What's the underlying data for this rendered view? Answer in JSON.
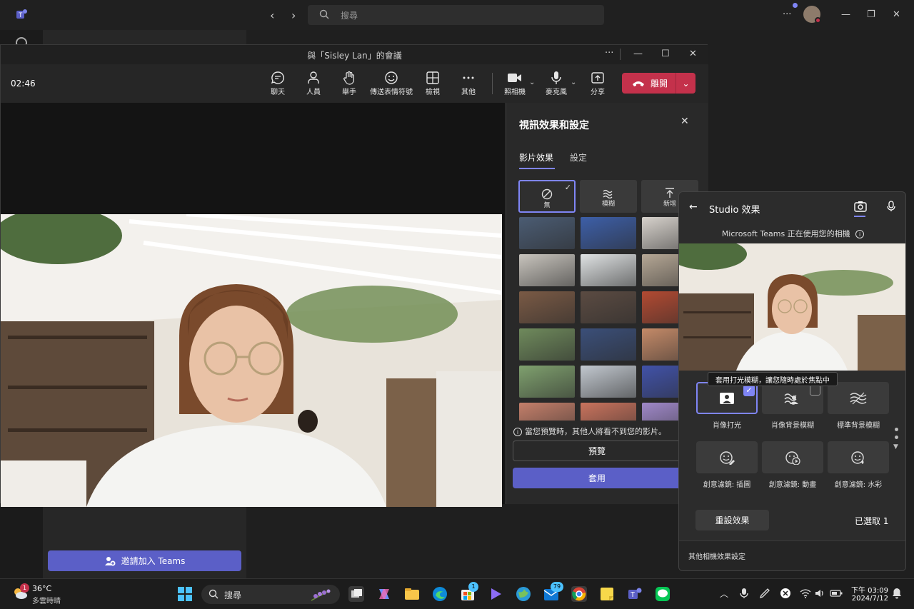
{
  "topbar": {
    "search_placeholder": "搜尋"
  },
  "meeting": {
    "title": "與「Sisley Lan」的會議",
    "timer": "02:46",
    "toolbar": [
      {
        "label": "聊天",
        "icon": "chat-icon"
      },
      {
        "label": "人員",
        "icon": "people-icon"
      },
      {
        "label": "舉手",
        "icon": "hand-icon"
      },
      {
        "label": "傳送表情符號",
        "icon": "emoji-icon"
      },
      {
        "label": "檢視",
        "icon": "grid-icon"
      },
      {
        "label": "其他",
        "icon": "more-icon"
      },
      {
        "label": "照相機",
        "icon": "camera-icon"
      },
      {
        "label": "麥克風",
        "icon": "mic-icon"
      },
      {
        "label": "分享",
        "icon": "share-icon"
      }
    ],
    "leave_label": "離開"
  },
  "panel": {
    "title": "視訊效果和設定",
    "tabs": [
      "影片效果",
      "設定"
    ],
    "effects": [
      {
        "label": "無"
      },
      {
        "label": "模糊"
      },
      {
        "label": "新增"
      }
    ],
    "info": "當您預覽時，其他人將看不到您的影片。",
    "preview": "預覽",
    "apply": "套用",
    "thumb_colors": [
      [
        "#4b5c73",
        "#3d5fa8",
        "#d7d2cc"
      ],
      [
        "#c8c4bd",
        "#dfe2e3",
        "#b5a795"
      ],
      [
        "#7a5a45",
        "#5b4b42",
        "#b24a32"
      ],
      [
        "#6f8a5c",
        "#3b4f79",
        "#c48a68"
      ],
      [
        "#7fa06e",
        "#c2c8cf",
        "#4152a8"
      ],
      [
        "#c47f6a",
        "#c9735d",
        "#9f88c8"
      ]
    ]
  },
  "studio": {
    "title": "Studio 效果",
    "info": "Microsoft Teams 正在使用您的相機",
    "tooltip": "套用打光模糊，讓您隨時處於焦點中",
    "options": [
      {
        "label": "肖像打光",
        "icon": "portrait-light-icon"
      },
      {
        "label": "肖像背景模糊",
        "icon": "portrait-blur-icon"
      },
      {
        "label": "標準背景模糊",
        "icon": "standard-blur-icon"
      },
      {
        "label": "創意濾鏡: 插圖",
        "icon": "filter-illustration-icon"
      },
      {
        "label": "創意濾鏡: 動畫",
        "icon": "filter-animation-icon"
      },
      {
        "label": "創意濾鏡: 水彩",
        "icon": "filter-watercolor-icon"
      }
    ],
    "reset": "重設效果",
    "selected": "已選取 1",
    "footer": "其他相機效果設定"
  },
  "sidebar_invite": "邀請加入 Teams",
  "taskbar": {
    "weather_temp": "36°C",
    "weather_desc": "多雲時晴",
    "weather_badge": "1",
    "search": "搜尋",
    "badge_store": "1",
    "badge_mail": "79",
    "time_line1": "下午 03:09",
    "time_line2": "2024/7/12"
  }
}
